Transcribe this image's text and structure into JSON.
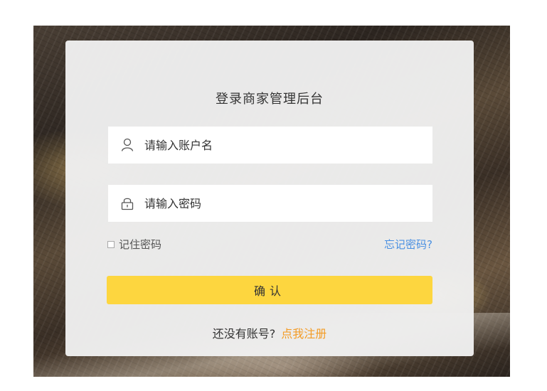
{
  "login": {
    "title": "登录商家管理后台",
    "username_placeholder": "请输入账户名",
    "password_placeholder": "请输入密码",
    "remember_label": "记住密码",
    "forgot_link": "忘记密码?",
    "confirm_label": "确认",
    "no_account_text": "还没有账号?",
    "register_link": "点我注册"
  },
  "icons": {
    "username": "user-icon",
    "password": "lock-icon",
    "remember": "checkbox-icon"
  },
  "colors": {
    "confirm_button": "#fdd63f",
    "forgot_link": "#4a90e2",
    "register_link": "#f39c26",
    "card_background": "#f0f0f0"
  }
}
